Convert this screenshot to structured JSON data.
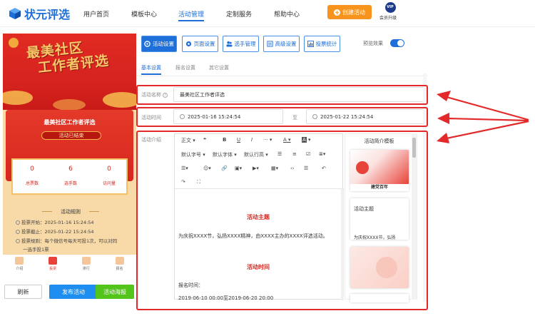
{
  "brand": {
    "name": "状元评选",
    "color": "#1e6fd9"
  },
  "nav": [
    {
      "label": "用户首页"
    },
    {
      "label": "模板中心"
    },
    {
      "label": "活动管理",
      "active": true
    },
    {
      "label": "定制服务"
    },
    {
      "label": "帮助中心"
    }
  ],
  "header": {
    "create_label": "创建活动",
    "vip_badge": "VIP",
    "vip_label": "会员升级"
  },
  "preview": {
    "banner_line1": "最美社区",
    "banner_line2": "工作者评选",
    "title": "最美社区工作者评选",
    "status": "活动已结束",
    "stats": [
      {
        "value": "0",
        "label": "总票数"
      },
      {
        "value": "6",
        "label": "选手数"
      },
      {
        "value": "0",
        "label": "访问量"
      }
    ],
    "rules_title": "活动规则",
    "rules": [
      "投票开始：2025-01-16 15:24:54",
      "投票截止：2025-01-22 15:24:54",
      "投票规则：每个微信号每天可投1次，可以对同",
      "一选手投1票"
    ],
    "bottom_nav": [
      "介绍",
      "投票",
      "排行",
      "报名"
    ]
  },
  "actions": {
    "refresh": "刷新",
    "publish": "发布活动",
    "poster": "活动海报"
  },
  "toolbar_tabs": [
    {
      "label": "活动设置",
      "active": true
    },
    {
      "label": "页面设置"
    },
    {
      "label": "选手管理"
    },
    {
      "label": "高级设置"
    },
    {
      "label": "投票统计"
    }
  ],
  "preview_toggle_label": "预览效果",
  "subtabs": [
    "基本设置",
    "报名设置",
    "其它设置"
  ],
  "form": {
    "name_label": "活动名称",
    "name_value": "最美社区工作者评选",
    "time_label": "活动时间",
    "start": "2025-01-16 15:24:54",
    "to": "至",
    "end": "2025-01-22 15:24:54",
    "intro_label": "活动介绍"
  },
  "editor": {
    "toolbar_row1": [
      "正文",
      "❝",
      "B",
      "U",
      "I",
      "···",
      "A",
      "A"
    ],
    "toolbar_row2": [
      "默认字号",
      "默认字体",
      "默认行高"
    ],
    "content": {
      "head1": "活动主题",
      "para1": "为庆祝XXXX节，弘扬XXXX精神，由XXXX主办的XXXX评选活动。",
      "head2": "活动时间",
      "para2": "报名时间：",
      "para3": "2019-06-10 00:00至2019-06-20 20:00"
    }
  },
  "templates": {
    "title": "活动简介模板",
    "card1_caption": "建党百年",
    "card2_title": "活动主题",
    "card2_text": "为庆祝XXXX节，弘扬"
  },
  "colors": {
    "highlight": "#e32a2a",
    "orange": "#f7941d",
    "red": "#d8261e",
    "green": "#52c41a"
  }
}
